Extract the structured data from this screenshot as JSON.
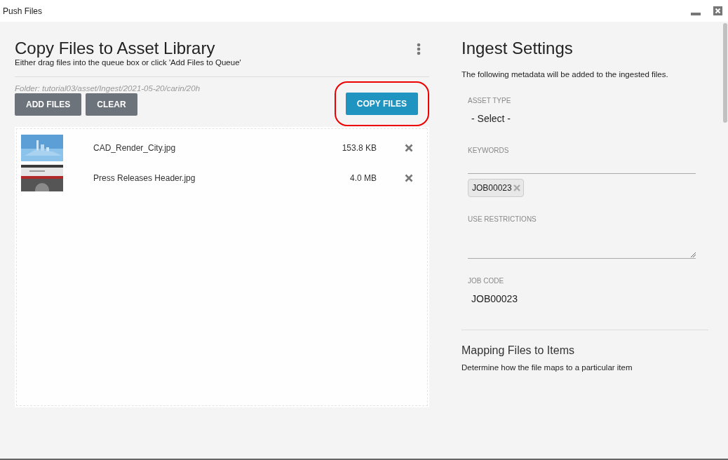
{
  "window": {
    "title": "Push Files"
  },
  "left": {
    "title": "Copy Files to Asset Library",
    "subtitle": "Either drag files into the queue box or click 'Add Files to Queue'",
    "folder": "Folder: tutorial03/asset/Ingest/2021-05-20/carin/20h",
    "buttons": [
      {
        "label": "ADD FILES",
        "kind": "secondary",
        "highlighted": false
      },
      {
        "label": "CLEAR",
        "kind": "secondary",
        "highlighted": false
      },
      {
        "label": "COPY FILES",
        "kind": "primary",
        "highlighted": true
      }
    ],
    "files": [
      {
        "name": "CAD_Render_City.jpg",
        "size": "153.8 KB"
      },
      {
        "name": "Press Releases Header.jpg",
        "size": "4.0 MB"
      }
    ]
  },
  "right": {
    "title": "Ingest Settings",
    "description": "The following metadata will be added to the ingested files.",
    "fields": [
      {
        "label": "ASSET TYPE",
        "kind": "select",
        "value": "- Select -"
      },
      {
        "label": "KEYWORDS",
        "kind": "tags",
        "tags": [
          "JOB00023"
        ]
      },
      {
        "label": "USE RESTRICTIONS",
        "kind": "textarea"
      },
      {
        "label": "JOB CODE",
        "kind": "text",
        "value": "JOB00023"
      }
    ],
    "mapping": {
      "title": "Mapping Files to Items",
      "description": "Determine how the file maps to a particular item"
    }
  }
}
